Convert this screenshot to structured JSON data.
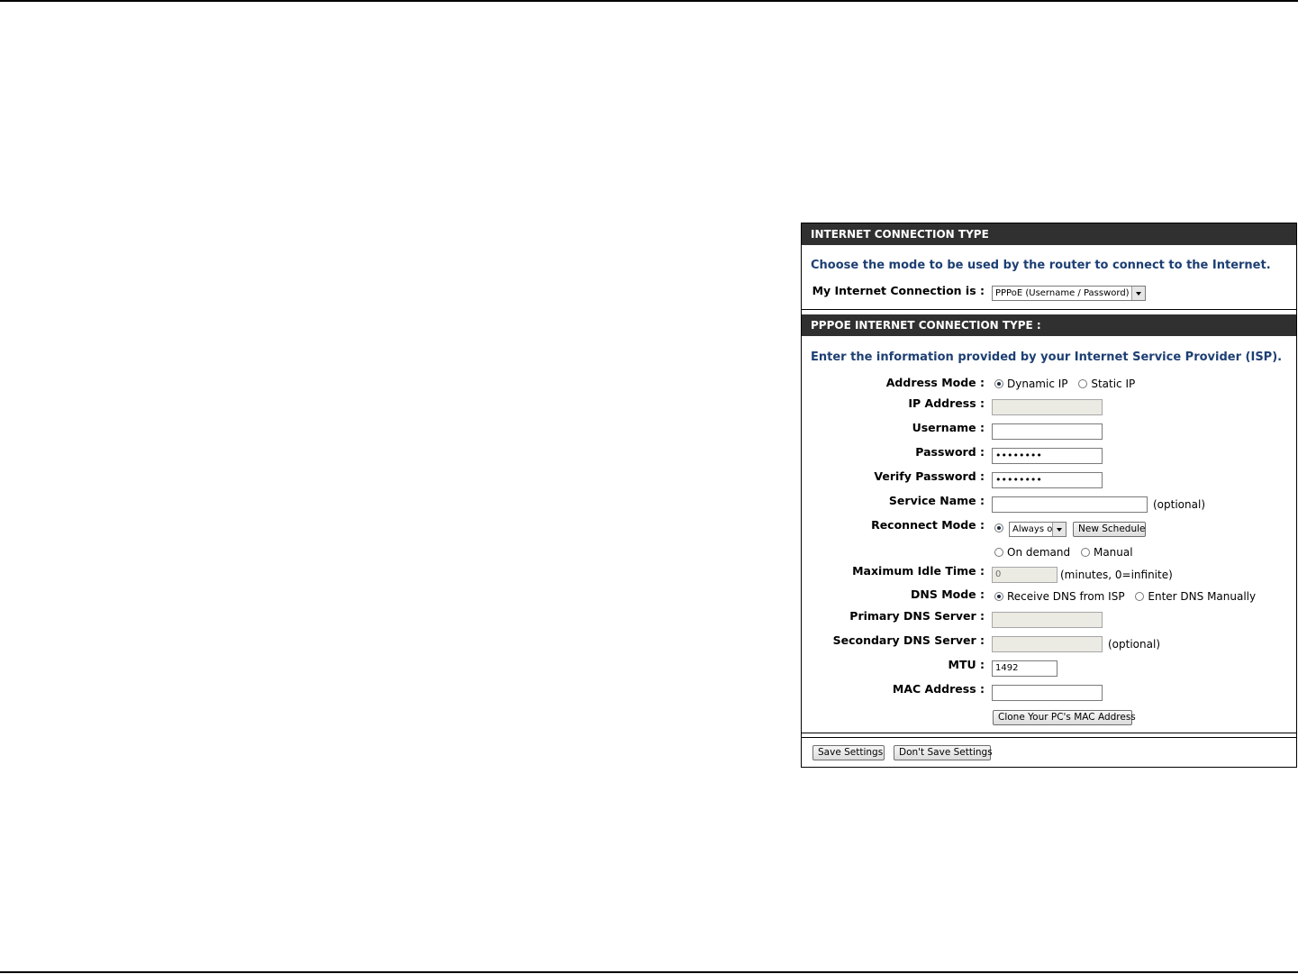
{
  "connection_type": {
    "header": "INTERNET CONNECTION TYPE",
    "intro": "Choose the mode to be used by the router to connect to the Internet.",
    "label": "My Internet Connection is :",
    "selected": "PPPoE (Username / Password)"
  },
  "pppoe": {
    "header": "PPPOE INTERNET CONNECTION TYPE :",
    "intro": "Enter the information provided by your Internet Service Provider (ISP).",
    "address_mode": {
      "label": "Address Mode :",
      "opt_dynamic": "Dynamic IP",
      "opt_static": "Static IP",
      "selected": "dynamic"
    },
    "ip_address": {
      "label": "IP Address :",
      "value": ""
    },
    "username": {
      "label": "Username :",
      "value": ""
    },
    "password": {
      "label": "Password :",
      "value": "••••••••"
    },
    "verify_password": {
      "label": "Verify Password :",
      "value": "••••••••"
    },
    "service_name": {
      "label": "Service Name :",
      "value": "",
      "note": "(optional)"
    },
    "reconnect_mode": {
      "label": "Reconnect Mode :",
      "schedule_selected": "Always o",
      "new_schedule_label": "New Schedule",
      "opt_on_demand": "On demand",
      "opt_manual": "Manual"
    },
    "max_idle_time": {
      "label": "Maximum Idle Time :",
      "value": "0",
      "note": "(minutes, 0=infinite)"
    },
    "dns_mode": {
      "label": "DNS Mode :",
      "opt_isp": "Receive DNS from ISP",
      "opt_manual": "Enter DNS Manually"
    },
    "primary_dns": {
      "label": "Primary DNS Server :",
      "value": ""
    },
    "secondary_dns": {
      "label": "Secondary DNS Server :",
      "value": "",
      "note": "(optional)"
    },
    "mtu": {
      "label": "MTU :",
      "value": "1492"
    },
    "mac_address": {
      "label": "MAC Address :",
      "value": ""
    },
    "clone_mac_label": "Clone Your PC's MAC Address"
  },
  "actions": {
    "save_label": "Save Settings",
    "dont_save_label": "Don't Save Settings"
  },
  "colors": {
    "header_bg": "#303030",
    "intro_text": "#1d3f73"
  }
}
